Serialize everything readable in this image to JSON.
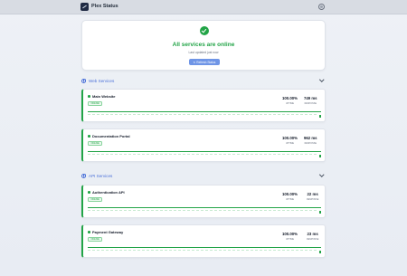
{
  "app": {
    "title": "Plex Status"
  },
  "summary": {
    "title": "All services are online",
    "subtitle": "Last updated just now",
    "refresh_label": "Refresh Status"
  },
  "colors": {
    "ok": "#22a447",
    "accent": "#4c72d9",
    "button": "#6f95e6"
  },
  "sections": [
    {
      "title": "Web Services",
      "services": [
        {
          "name": "Main Website",
          "status": "ONLINE",
          "uptime": "100.00%",
          "uptime_label": "UPTIME",
          "response": "749 ms",
          "response_label": "RESPONSE",
          "uptime_fraction": 1.0
        },
        {
          "name": "Documentation Portal",
          "status": "ONLINE",
          "uptime": "100.00%",
          "uptime_label": "UPTIME",
          "response": "962 ms",
          "response_label": "RESPONSE",
          "uptime_fraction": 1.0
        }
      ]
    },
    {
      "title": "API Services",
      "services": [
        {
          "name": "Authentication API",
          "status": "ONLINE",
          "uptime": "100.00%",
          "uptime_label": "UPTIME",
          "response": "22 ms",
          "response_label": "RESPONSE",
          "uptime_fraction": 1.0
        },
        {
          "name": "Payment Gateway",
          "status": "ONLINE",
          "uptime": "100.00%",
          "uptime_label": "UPTIME",
          "response": "23 ms",
          "response_label": "RESPONSE",
          "uptime_fraction": 1.0
        }
      ]
    }
  ],
  "icons": {
    "logo": "plex-logo-icon",
    "theme": "theme-toggle-icon",
    "ok": "check-circle-icon",
    "refresh": "refresh-icon",
    "section": "globe-icon",
    "collapse": "chevron-down-icon"
  }
}
